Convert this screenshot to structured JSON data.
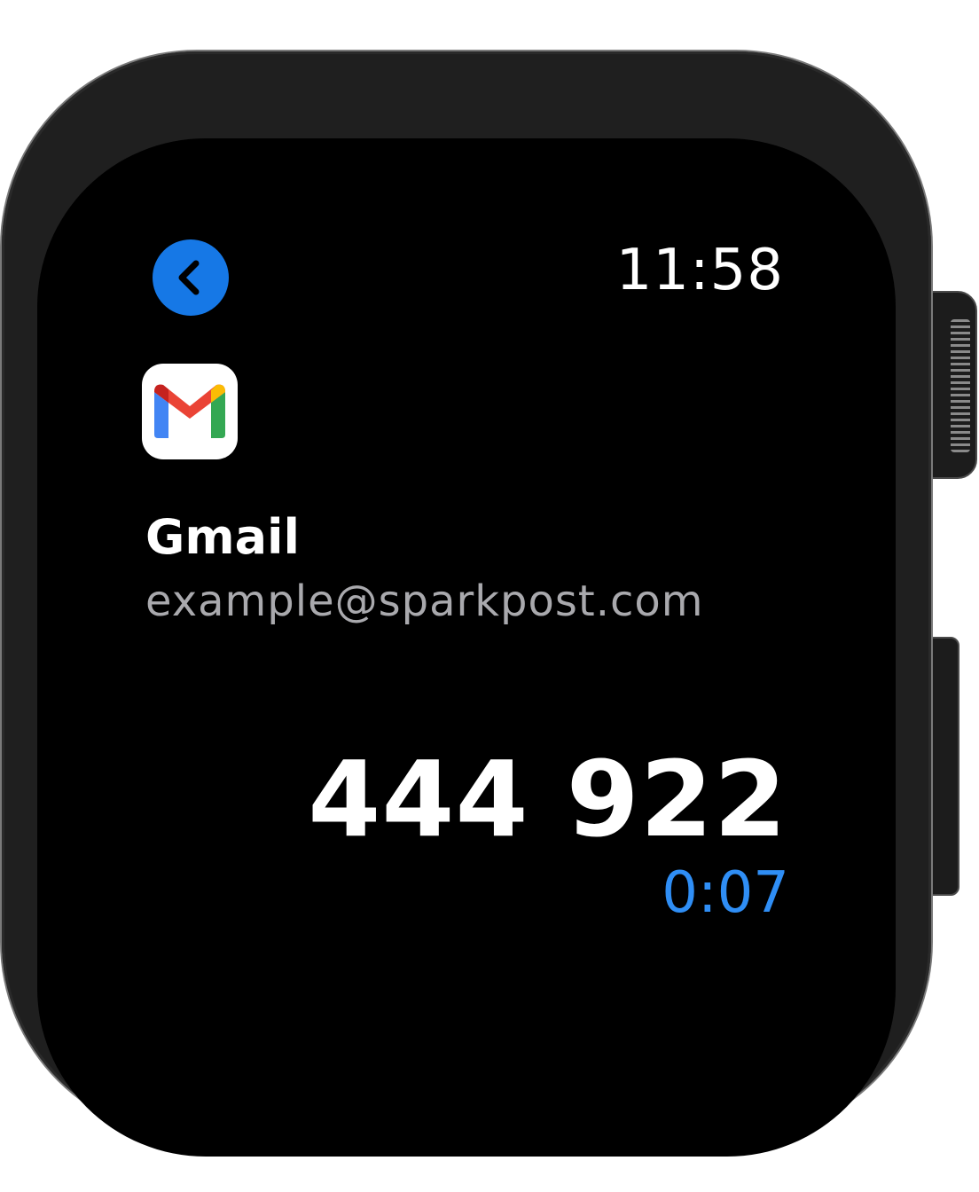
{
  "status_bar": {
    "time": "11:58"
  },
  "navigation": {
    "back_icon": "chevron-left-icon"
  },
  "account": {
    "app_icon": "gmail-logo-icon",
    "name": "Gmail",
    "email": "example@sparkpost.com"
  },
  "otp": {
    "code": "444 922",
    "remaining": "0:07"
  },
  "colors": {
    "accent": "#1678e6",
    "countdown": "#2f8ef5",
    "background": "#000000",
    "secondary_text": "#a9a9ad"
  }
}
